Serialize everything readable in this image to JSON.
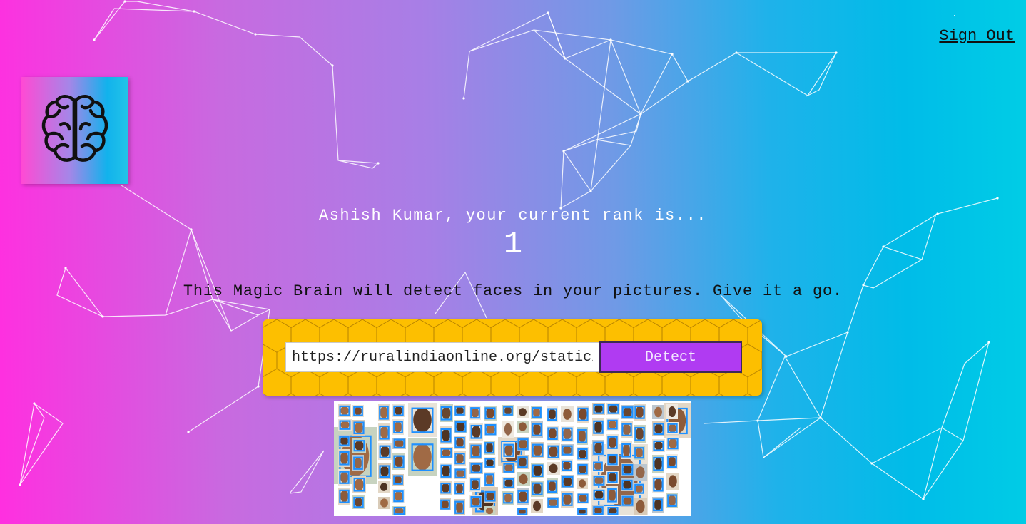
{
  "nav": {
    "sign_out_label": "Sign Out"
  },
  "logo": {
    "icon": "brain-icon"
  },
  "rank": {
    "message": "Ashish Kumar, your current rank is...",
    "value": "1"
  },
  "tagline": "This Magic Brain will detect faces in your pictures. Give it a go.",
  "image_link_form": {
    "input_value": "https://ruralindiaonline.org/static/",
    "button_label": "Detect"
  },
  "colors": {
    "gradient_left": "#ff2fe0",
    "gradient_right": "#00cde6",
    "panel_yellow": "#fdbf00",
    "button_purple": "#b03bf2",
    "face_box_blue": "#1e90ff"
  }
}
